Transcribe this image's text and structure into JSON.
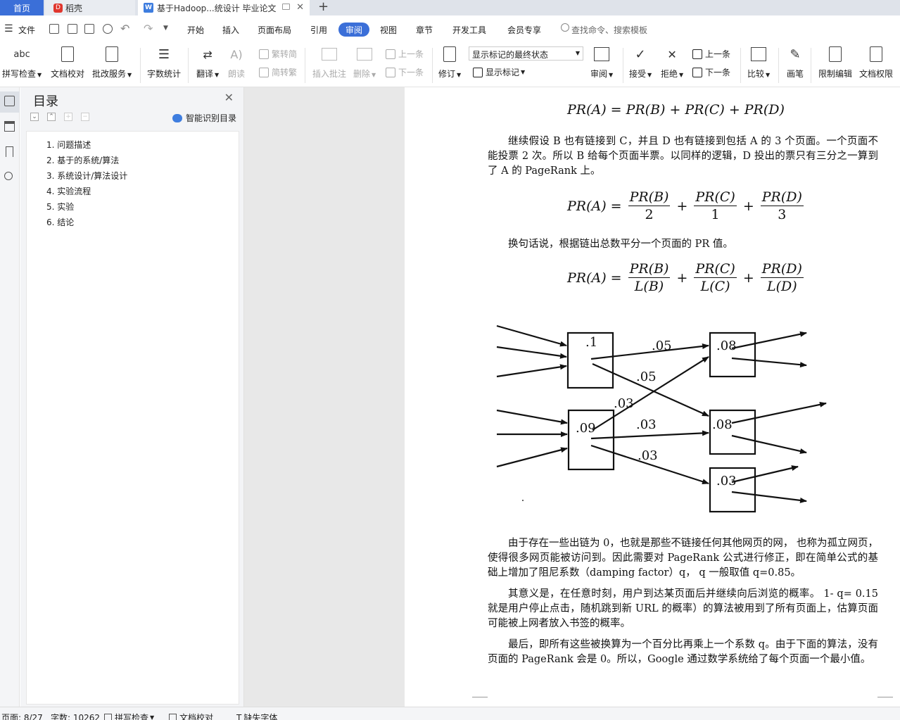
{
  "tabs": {
    "home": "首页",
    "daoke": "稻壳",
    "doc": "基于Hadoop...统设计 毕业论文"
  },
  "menu": {
    "file": "文件",
    "items": [
      "开始",
      "插入",
      "页面布局",
      "引用",
      "审阅",
      "视图",
      "章节",
      "开发工具",
      "会员专享"
    ],
    "active": "审阅",
    "search": "查找命令、搜索模板"
  },
  "ribbon": {
    "spellcheck": "拼写检查",
    "doc_proof": "文档校对",
    "review_service": "批改服务",
    "word_count": "字数统计",
    "translate": "翻译",
    "read_aloud": "朗读",
    "to_traditional": "繁转简",
    "to_simplified": "简转繁",
    "insert_comment": "插入批注",
    "delete": "删除",
    "prev": "上一条",
    "next": "下一条",
    "track": "修订",
    "markup_select": "显示标记的最终状态",
    "show_markup": "显示标记",
    "review": "审阅",
    "accept": "接受",
    "reject": "拒绝",
    "prev2": "上一条",
    "next2": "下一条",
    "compare": "比较",
    "pen": "画笔",
    "restrict": "限制编辑",
    "permission": "文档权限"
  },
  "toc": {
    "title": "目录",
    "smart": "智能识别目录",
    "items": [
      "1. 问题描述",
      "2. 基于的系统/算法",
      "3. 系统设计/算法设计",
      "4. 实验流程",
      "5. 实验",
      "6. 结论"
    ]
  },
  "doc": {
    "para1": "继续假设 B 也有链接到 C，并且 D 也有链接到包括 A 的 3 个页面。一个页面不能投票 2 次。所以 B 给每个页面半票。以同样的逻辑，D 投出的票只有三分之一算到了 A 的 PageRank 上。",
    "para2": "换句话说，根据链出总数平分一个页面的 PR 值。",
    "para3": "由于存在一些出链为 0，也就是那些不链接任何其他网页的网， 也称为孤立网页，使得很多网页能被访问到。因此需要对 PageRank 公式进行修正，即在简单公式的基础上增加了阻尼系数（damping factor）q， q 一般取值 q=0.85。",
    "para4": "其意义是，在任意时刻，用户到达某页面后并继续向后浏览的概率。 1- q= 0.15 就是用户停止点击，随机跳到新 URL 的概率）的算法被用到了所有页面上，估算页面可能被上网者放入书签的概率。",
    "para5": "最后，即所有这些被换算为一个百分比再乘上一个系数 q。由于下面的算法，没有页面的 PageRank 会是 0。所以，Google 通过数学系统给了每个页面一个最小值。",
    "eq": {
      "lhs": "PR(A)",
      "eq": "=",
      "plus": "+",
      "t1": "PR(B)",
      "t2": "PR(C)",
      "t3": "PR(D)",
      "d1": "2",
      "d2": "1",
      "d3": "3",
      "l1": "L(B)",
      "l2": "L(C)",
      "l3": "L(D)"
    },
    "diagram": {
      "nodes": [
        ".1",
        ".09",
        ".08",
        ".08",
        ".03"
      ],
      "edges": [
        ".05",
        ".05",
        ".03",
        ".03",
        ".03"
      ]
    }
  },
  "status": {
    "page": "页面: 8/27",
    "words": "字数: 10262",
    "spell": "拼写检查",
    "proof": "文档校对",
    "font": "缺失字体"
  }
}
